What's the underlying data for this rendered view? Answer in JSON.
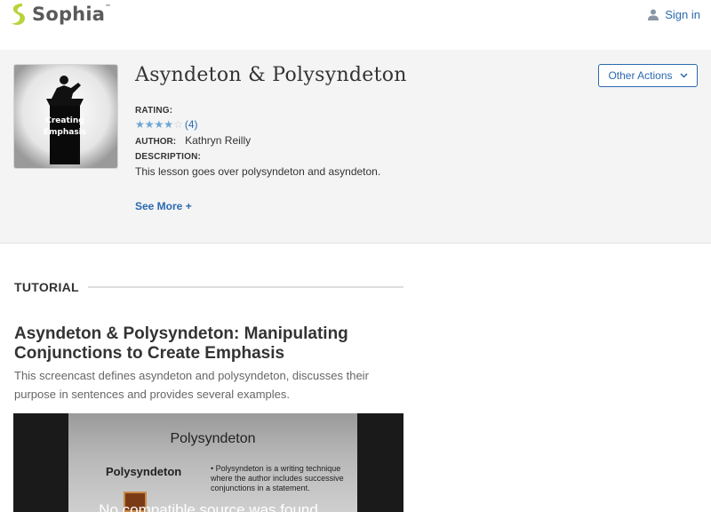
{
  "header": {
    "brand": "Sophia",
    "brand_tm": "™",
    "signin_label": "Sign in"
  },
  "lesson": {
    "title": "Asyndeton & Polysyndeton",
    "thumbnail_text_1": "Creating",
    "thumbnail_text_2": "Emphasis",
    "other_actions_label": "Other Actions",
    "rating_label": "RATING:",
    "rating_value": 3.5,
    "rating_max": 5,
    "rating_count": "(4)",
    "author_label": "AUTHOR:",
    "author_name": "Kathryn Reilly",
    "description_label": "DESCRIPTION:",
    "description": "This lesson goes over polysyndeton and asyndeton.",
    "see_more_label": "See More +"
  },
  "tutorial": {
    "section_label": "TUTORIAL",
    "title": "Asyndeton & Polysyndeton: Manipulating Conjunctions to Create Emphasis",
    "description": "This screencast defines asyndeton and polysyndeton, discusses their purpose in sentences and provides several examples."
  },
  "video": {
    "slide_title": "Polysyndeton",
    "slide_subtitle": "Polysyndeton",
    "slide_bullet": "Polysyndeton is a writing technique where the author includes successive conjunctions in a statement.",
    "error_message": "No compatible source was found"
  },
  "colors": {
    "link_blue": "#2a6ab0",
    "brand_green": "#b7d33a",
    "star_blue": "#6aa6d6"
  }
}
